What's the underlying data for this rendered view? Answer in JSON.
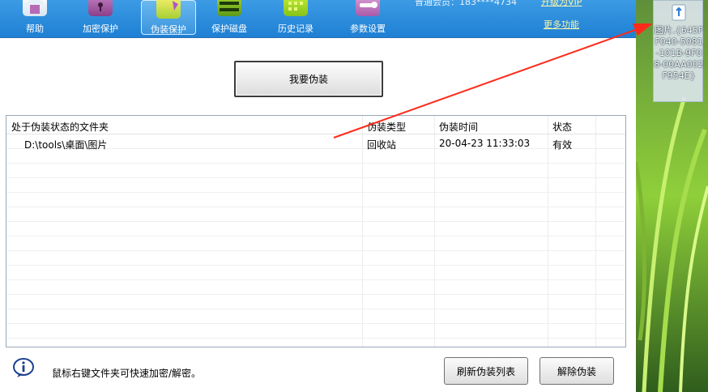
{
  "toolbar": {
    "items": [
      {
        "label": "帮助",
        "icon": "home-icon"
      },
      {
        "label": "加密保护",
        "icon": "lock-icon"
      },
      {
        "label": "伪装保护",
        "icon": "disguise-icon"
      },
      {
        "label": "保护磁盘",
        "icon": "disk-icon"
      },
      {
        "label": "历史记录",
        "icon": "history-icon"
      },
      {
        "label": "参数设置",
        "icon": "wrench-icon"
      }
    ],
    "member_text": "普通会员：183****4734",
    "upgrade_link": "升级为VIP",
    "more_link": "更多功能"
  },
  "main": {
    "disguise_button": "我要伪装"
  },
  "table": {
    "headers": [
      "处于伪装状态的文件夹",
      "伪装类型",
      "伪装时间",
      "状态"
    ],
    "rows": [
      {
        "folder": "D:\\tools\\桌面\\图片",
        "type": "回收站",
        "time": "20-04-23 11:33:03",
        "status": "有效"
      }
    ]
  },
  "footer": {
    "tip": "鼠标右键文件夹可快速加密/解密。",
    "refresh_button": "刷新伪装列表",
    "remove_button": "解除伪装"
  },
  "desktop": {
    "icon_label": "图片.{645FF040-5081-101B-9F08-00AA002F954E}"
  },
  "colors": {
    "toolbar": "#2b8ad9",
    "arrow": "#ff2a1a",
    "link": "#fff6a8"
  }
}
